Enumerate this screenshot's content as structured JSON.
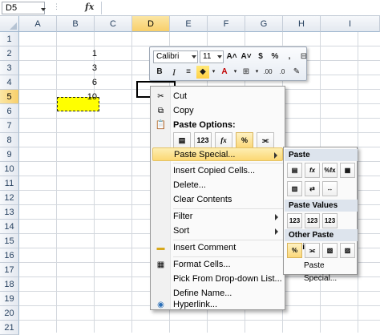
{
  "formula_bar": {
    "name_box": "D5",
    "fx_label": "fx",
    "formula": ""
  },
  "columns": [
    "A",
    "B",
    "C",
    "D",
    "E",
    "F",
    "G",
    "H",
    "I"
  ],
  "rows": [
    "1",
    "2",
    "3",
    "4",
    "5",
    "6",
    "7",
    "8",
    "9",
    "10",
    "11",
    "12",
    "13",
    "14",
    "15",
    "16",
    "17",
    "18",
    "19",
    "20",
    "21"
  ],
  "cells": {
    "B2": "1",
    "B3": "3",
    "B4": "6",
    "B5": "10"
  },
  "selection": {
    "active_cell": "D5",
    "copied_cell": "B5"
  },
  "mini_toolbar": {
    "font": "Calibri",
    "size": "11",
    "grow_font": "A˄",
    "shrink_font": "A˅",
    "currency": "$",
    "percent": "%",
    "comma": ",",
    "bold": "B",
    "italic": "I",
    "center": "≡",
    "fill_color": "◆",
    "font_color": "A",
    "borders": "⊞",
    "decrease_decimal": ".00",
    "increase_decimal": ".0",
    "format_painter": "✎"
  },
  "context_menu": {
    "cut": "Cut",
    "copy": "Copy",
    "paste_options": "Paste Options:",
    "paste_buttons": [
      "▤",
      "123",
      "fx",
      "%",
      "⫘"
    ],
    "paste_special": "Paste Special...",
    "insert_copied_cells": "Insert Copied Cells...",
    "delete": "Delete...",
    "clear_contents": "Clear Contents",
    "filter": "Filter",
    "sort": "Sort",
    "insert_comment": "Insert Comment",
    "format_cells": "Format Cells...",
    "pick_from_list": "Pick From Drop-down List...",
    "define_name": "Define Name...",
    "hyperlink": "Hyperlink..."
  },
  "paste_submenu": {
    "paste_header": "Paste",
    "paste_row1": [
      "▤",
      "fx",
      "%fx",
      "▦"
    ],
    "paste_row2": [
      "▥",
      "⇄",
      "↔"
    ],
    "values_header": "Paste Values",
    "values_row": [
      "123",
      "123",
      "123"
    ],
    "other_header": "Other Paste Options",
    "other_row": [
      "%",
      "⫘",
      "▧",
      "▨"
    ],
    "paste_special_link": "Paste Special..."
  },
  "colors": {
    "accent": "#fcd873",
    "copied_fill": "#ffff00",
    "header_bg": "#e4e9f0"
  }
}
